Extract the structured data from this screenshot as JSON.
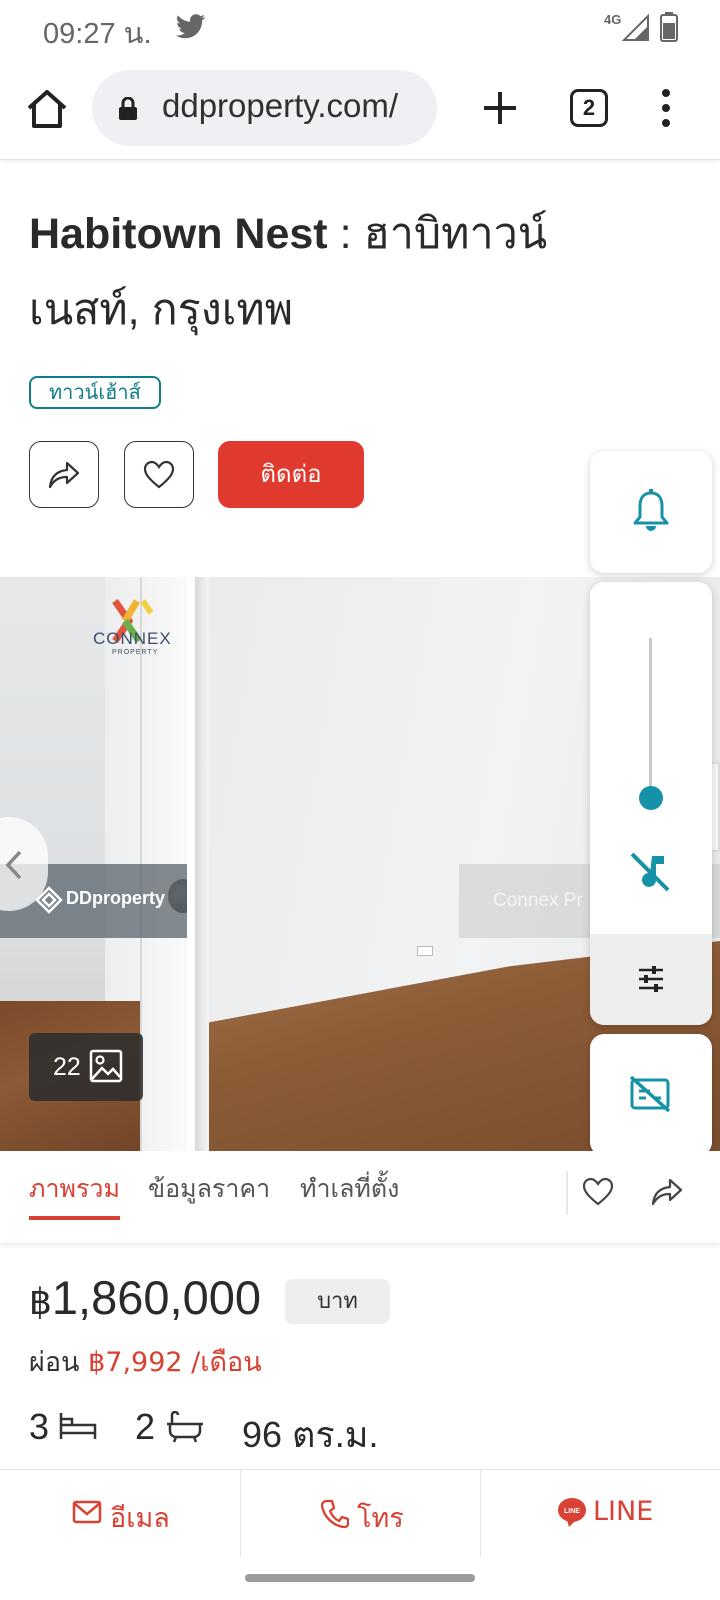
{
  "status_bar": {
    "time": "09:27 น.",
    "network": "4G"
  },
  "browser": {
    "url": "ddproperty.com/",
    "tab_count": "2"
  },
  "listing": {
    "title_en": "Habitown Nest",
    "title_sep": " : ",
    "title_th": "ฮาบิทาวน์ เนสท์, กรุงเทพ",
    "tag": "ทาวน์เฮ้าส์",
    "contact_label": "ติดต่อ"
  },
  "gallery": {
    "photo_count": "22",
    "watermark_brand": "CONNEX",
    "watermark_sub": "PROPERTY",
    "ddproperty_watermark": "DDproperty",
    "agent_watermark": "Connex Pr"
  },
  "section_tabs": [
    {
      "label": "ภาพรวม",
      "active": true
    },
    {
      "label": "ข้อมูลราคา",
      "active": false
    },
    {
      "label": "ทำเลที่ตั้ง",
      "active": false
    }
  ],
  "price": {
    "currency_symbol": "฿",
    "amount": "1,860,000",
    "unit": "บาท",
    "installment_prefix": "ผ่อน",
    "installment_amount": "฿7,992 /เดือน"
  },
  "specs": {
    "bedrooms": "3",
    "bathrooms": "2",
    "area": "96 ตร.ม."
  },
  "bottom_actions": {
    "email": "อีเมล",
    "call": "โทร",
    "line": "LINE"
  },
  "colors": {
    "accent_red": "#d94132",
    "teal": "#0e7f8a",
    "control_blue": "#1592a8"
  }
}
